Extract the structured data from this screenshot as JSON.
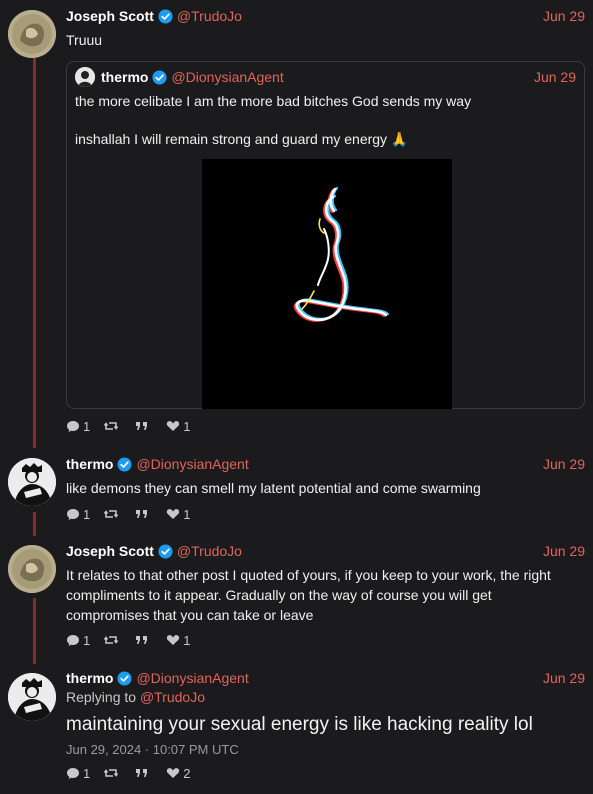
{
  "posts": [
    {
      "name": "Joseph Scott",
      "handle": "@TrudoJo",
      "date": "Jun 29",
      "text": "Truuu",
      "quote": {
        "name": "thermo",
        "handle": "@DionysianAgent",
        "date": "Jun 29",
        "text1": "the more celibate I am the more bad bitches God sends my way",
        "text2": "inshallah I will remain strong and guard my energy 🙏"
      },
      "stats": {
        "replies": "1",
        "reposts": "",
        "quotes": "",
        "likes": "1"
      }
    },
    {
      "name": "thermo",
      "handle": "@DionysianAgent",
      "date": "Jun 29",
      "text": "like demons they can smell my latent potential and come swarming",
      "stats": {
        "replies": "1",
        "reposts": "",
        "quotes": "",
        "likes": "1"
      }
    },
    {
      "name": "Joseph Scott",
      "handle": "@TrudoJo",
      "date": "Jun 29",
      "text": "It relates to that other post I quoted of yours, if you keep to your work, the right compliments to it appear. Gradually on the way of course you will get compromises that you can take or leave",
      "stats": {
        "replies": "1",
        "reposts": "",
        "quotes": "",
        "likes": "1"
      }
    },
    {
      "name": "thermo",
      "handle": "@DionysianAgent",
      "date": "Jun 29",
      "replying_prefix": "Replying to",
      "replying_handle": "@TrudoJo",
      "text": "maintaining your sexual energy is like hacking reality lol",
      "timestamp": "Jun 29, 2024 · 10:07 PM UTC",
      "stats": {
        "replies": "1",
        "reposts": "",
        "quotes": "",
        "likes": "2"
      }
    }
  ],
  "colors": {
    "accent": "#e0645a",
    "background": "#1b1b1d",
    "thread_line": "#8a2a2a",
    "verified": "#1d9bf0"
  },
  "icons": [
    "reply-icon",
    "repost-icon",
    "quote-icon",
    "like-icon",
    "verified-icon"
  ]
}
